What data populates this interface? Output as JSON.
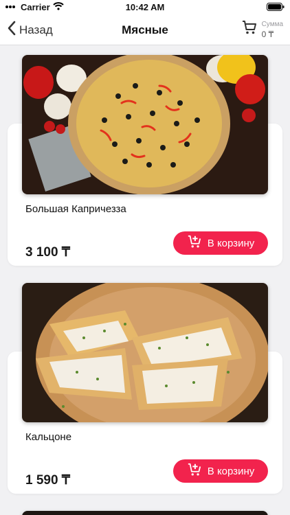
{
  "status_bar": {
    "carrier": "Carrier",
    "time": "10:42 AM"
  },
  "nav": {
    "back_label": "Назад",
    "title": "Мясные",
    "cart_label": "Сумма",
    "cart_sum": "0 ₸"
  },
  "products": [
    {
      "name": "Большая Капричезза",
      "price": "3 100 ₸",
      "button_label": "В корзину"
    },
    {
      "name": "Кальцоне",
      "price": "1 590 ₸",
      "button_label": "В корзину"
    }
  ],
  "icons": {
    "back": "chevron-left-icon",
    "cart": "shopping-cart-icon",
    "add_to_cart": "cart-plus-icon",
    "wifi": "wifi-icon",
    "battery": "battery-icon"
  },
  "colors": {
    "accent": "#f2234d",
    "background": "#f1f1f3"
  }
}
